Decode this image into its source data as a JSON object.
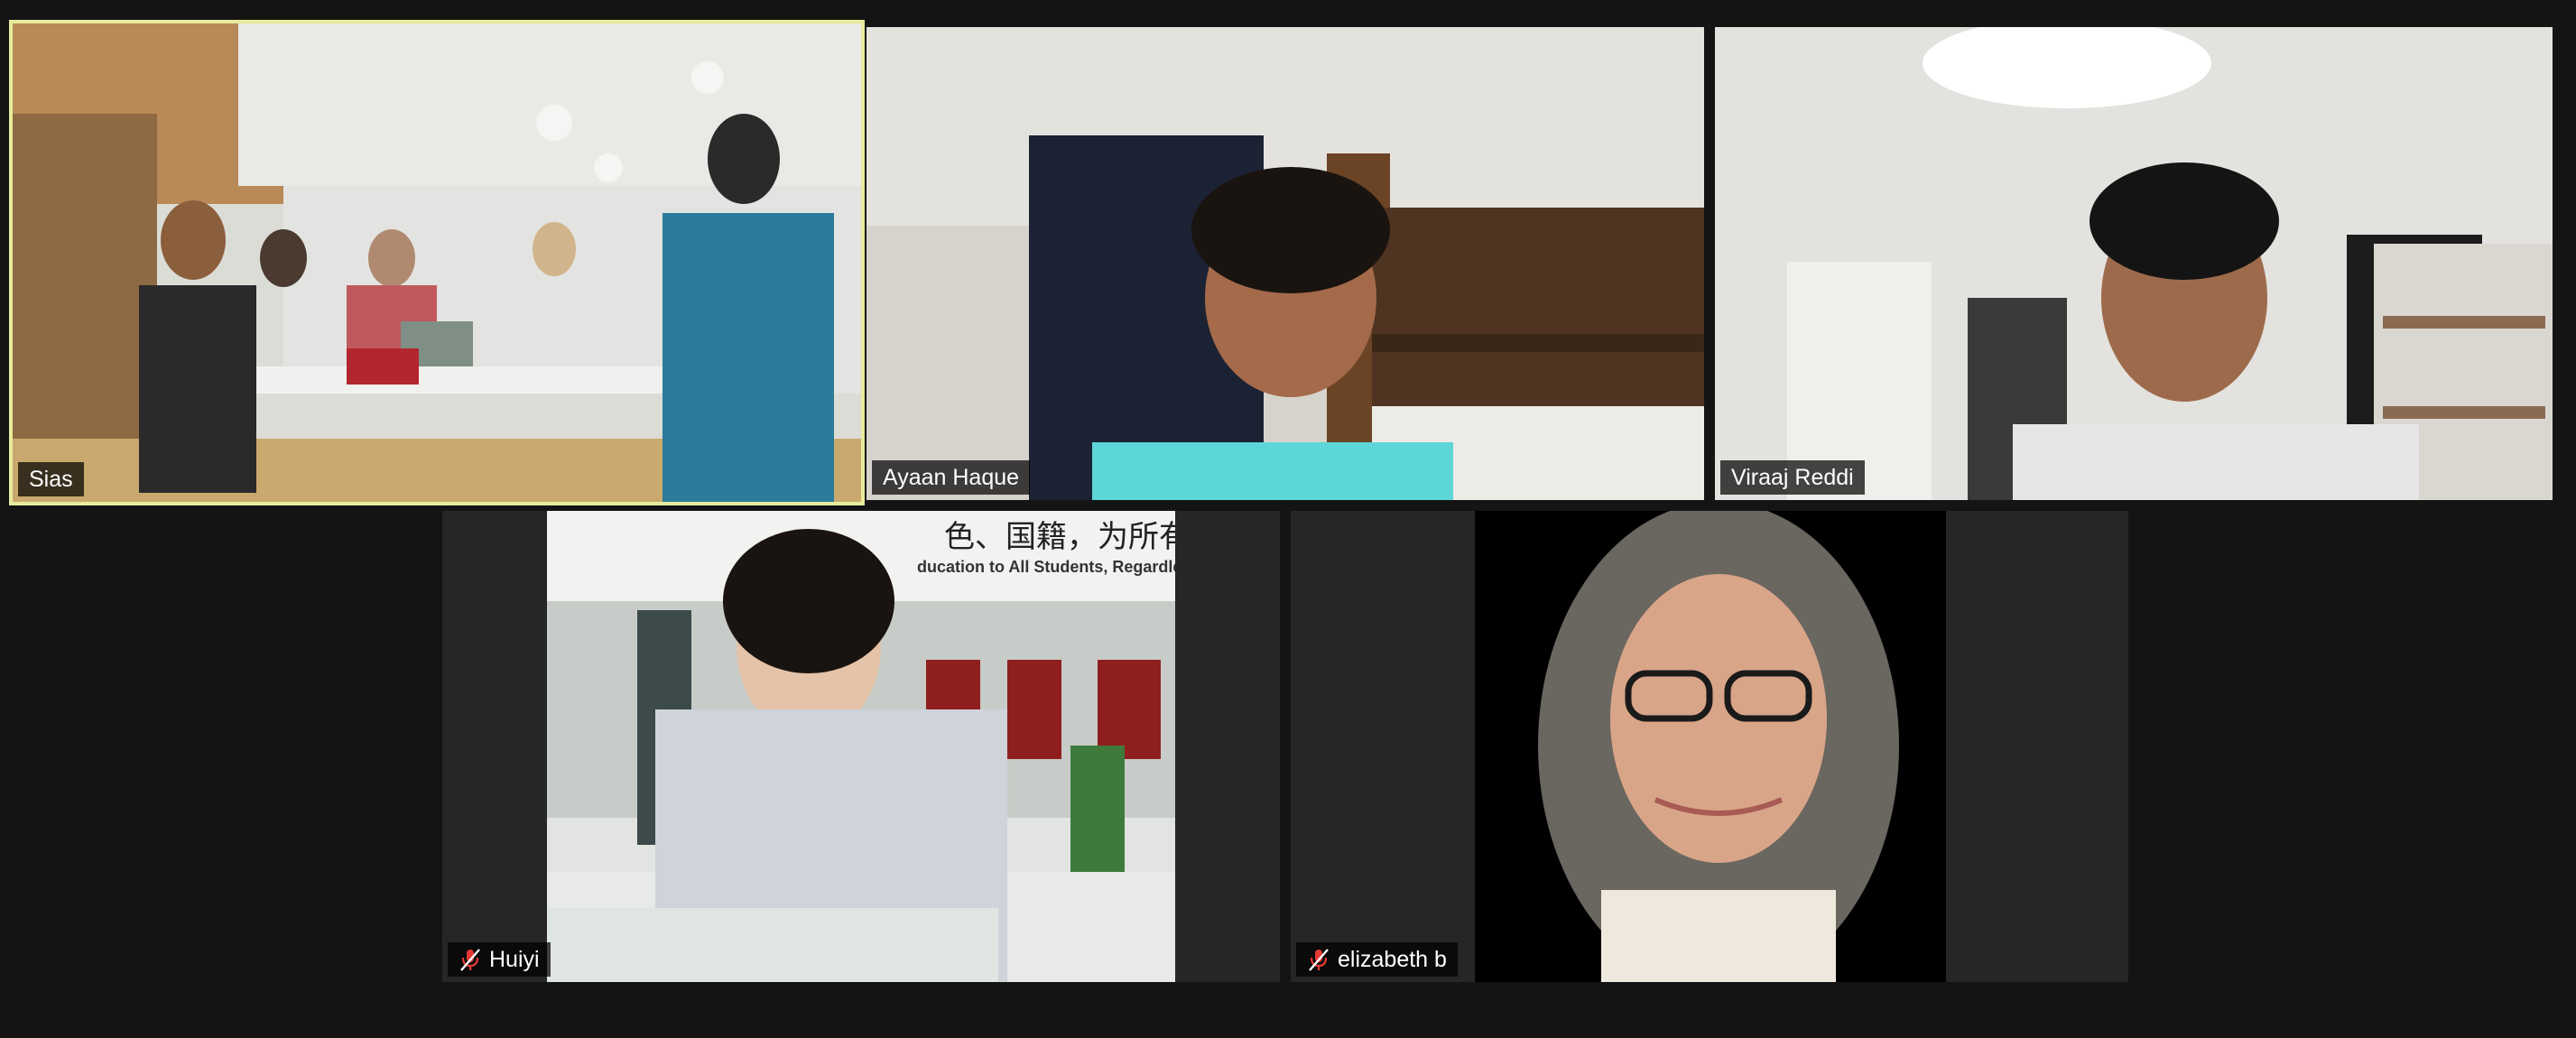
{
  "participants": [
    {
      "id": "sias",
      "name": "Sias",
      "muted": false,
      "active_speaker": true
    },
    {
      "id": "ayaan",
      "name": "Ayaan Haque",
      "muted": false,
      "active_speaker": false
    },
    {
      "id": "viraaj",
      "name": "Viraaj Reddi",
      "muted": false,
      "active_speaker": false
    },
    {
      "id": "huiyi",
      "name": "Huiyi",
      "muted": true,
      "active_speaker": false
    },
    {
      "id": "elizabeth",
      "name": "elizabeth b",
      "muted": true,
      "active_speaker": false
    }
  ],
  "background_texts": {
    "banner_cn": "色、国籍，为所有受教育者",
    "banner_en": "ducation to All Students, Regardless"
  },
  "colors": {
    "app_background": "#141414",
    "tile_background": "#262626",
    "active_speaker_border": "#e7ec9c",
    "muted_icon": "#e53935",
    "name_text": "#ffffff"
  },
  "icons": {
    "muted": "microphone-muted-icon"
  }
}
